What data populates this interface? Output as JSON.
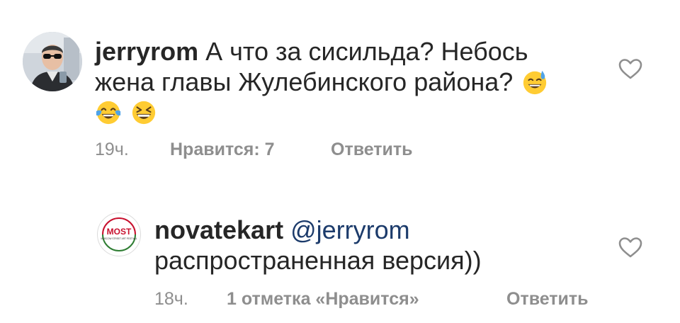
{
  "comments": [
    {
      "username": "jerryrom",
      "text_line1": "А что за сисильда? Небось",
      "text_line2": "жена главы Жулебинского района?",
      "emojis": [
        "downcast-face-with-sweat-emoji",
        "face-with-tears-of-joy-emoji",
        "grinning-squinting-face-emoji"
      ],
      "time": "19ч.",
      "likes": "Нравится: 7",
      "reply": "Ответить",
      "avatar_icon": "user-photo-avatar",
      "like_icon": "heart-outline-icon"
    },
    {
      "username": "novatekart",
      "mention": "@jerryrom",
      "text_line2": "распространенная версия))",
      "time": "18ч.",
      "likes": "1 отметка «Нравится»",
      "reply": "Ответить",
      "avatar_logo_text": "MOST",
      "avatar_logo_sub": "MOSCOW STREET ART FESTIVAL",
      "avatar_icon": "most-festival-logo",
      "like_icon": "heart-outline-icon"
    }
  ],
  "colors": {
    "text": "#262626",
    "secondary": "#8e8e8e",
    "mention": "#1c3b6b",
    "logo_red": "#c8102e",
    "logo_green": "#2e7d32"
  }
}
